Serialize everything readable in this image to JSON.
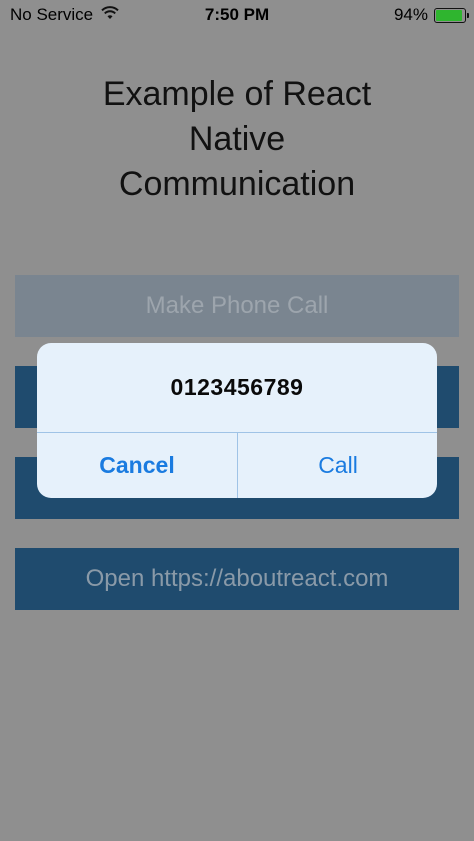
{
  "status_bar": {
    "carrier": "No Service",
    "time": "7:50 PM",
    "battery_percent": "94%",
    "battery_level": 0.94,
    "wifi_icon": "wifi-icon"
  },
  "title": "Example of React Native Communication",
  "buttons": {
    "phone": "Make Phone Call",
    "sms": "",
    "email": "",
    "url": "Open https://aboutreact.com"
  },
  "alert": {
    "message": "0123456789",
    "cancel_label": "Cancel",
    "call_label": "Call"
  },
  "colors": {
    "overlay": "#8f8f8f",
    "button_dark": "#1f4b6e",
    "alert_bg": "#e6f1fb",
    "alert_action": "#1a7be0",
    "battery": "#2fb52f"
  }
}
